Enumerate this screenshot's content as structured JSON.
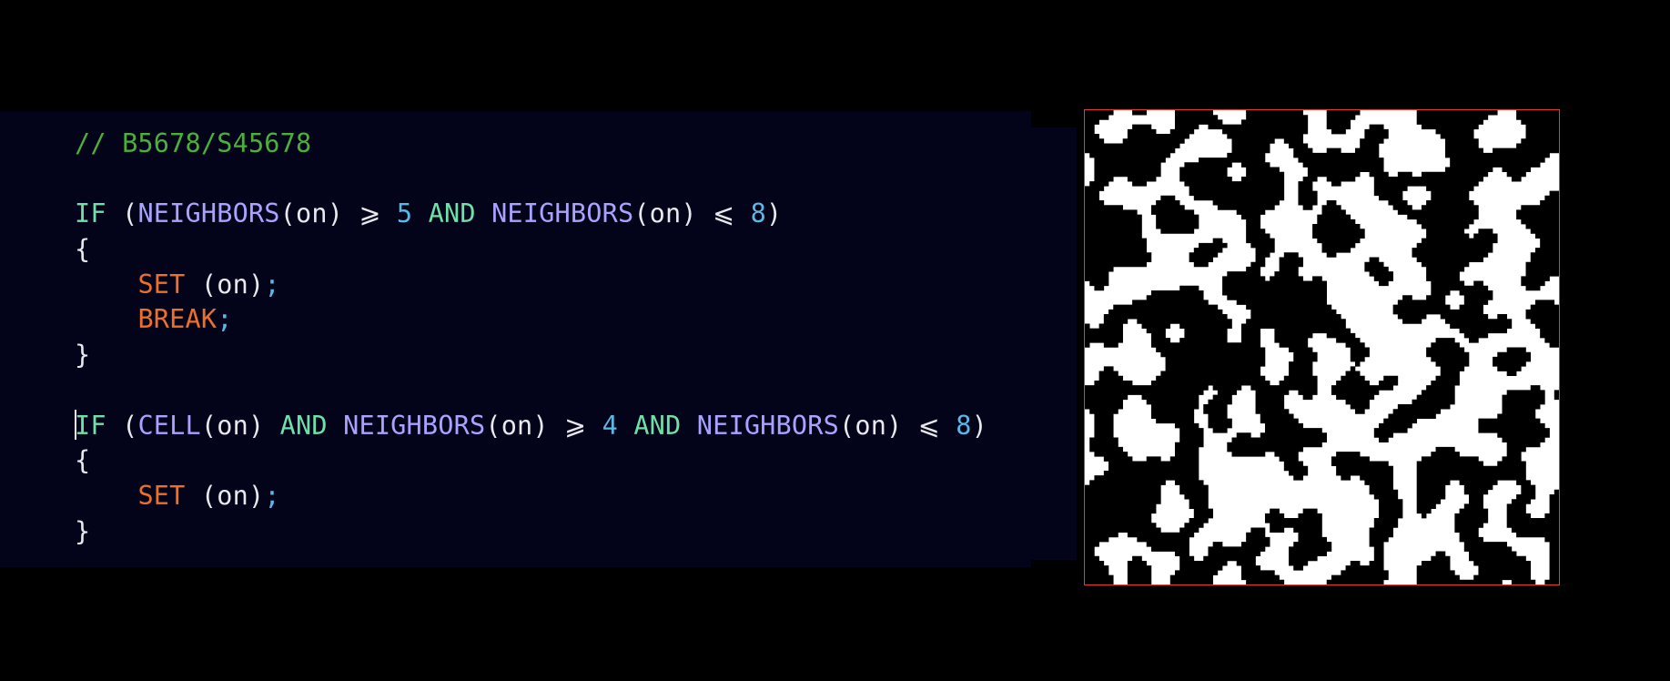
{
  "editor": {
    "lines": [
      [
        {
          "t": "// B5678/S45678",
          "c": "comment"
        }
      ],
      [],
      [
        {
          "t": "IF",
          "c": "kw"
        },
        {
          "t": " (",
          "c": "plain"
        },
        {
          "t": "NEIGHBORS",
          "c": "fn"
        },
        {
          "t": "(on) ",
          "c": "plain"
        },
        {
          "t": "⩾",
          "c": "op"
        },
        {
          "t": " ",
          "c": "plain"
        },
        {
          "t": "5",
          "c": "num"
        },
        {
          "t": " ",
          "c": "plain"
        },
        {
          "t": "AND",
          "c": "kw"
        },
        {
          "t": " ",
          "c": "plain"
        },
        {
          "t": "NEIGHBORS",
          "c": "fn"
        },
        {
          "t": "(on) ",
          "c": "plain"
        },
        {
          "t": "⩽",
          "c": "op"
        },
        {
          "t": " ",
          "c": "plain"
        },
        {
          "t": "8",
          "c": "num"
        },
        {
          "t": ")",
          "c": "plain"
        }
      ],
      [
        {
          "t": "{",
          "c": "plain"
        }
      ],
      [
        {
          "t": "    ",
          "c": "plain"
        },
        {
          "t": "SET",
          "c": "act"
        },
        {
          "t": " (on)",
          "c": "plain"
        },
        {
          "t": ";",
          "c": "semi"
        }
      ],
      [
        {
          "t": "    ",
          "c": "plain"
        },
        {
          "t": "BREAK",
          "c": "act"
        },
        {
          "t": ";",
          "c": "semi"
        }
      ],
      [
        {
          "t": "}",
          "c": "plain"
        }
      ],
      [],
      [
        {
          "t": "",
          "c": "caret"
        },
        {
          "t": "IF",
          "c": "kw"
        },
        {
          "t": " (",
          "c": "plain"
        },
        {
          "t": "CELL",
          "c": "fn"
        },
        {
          "t": "(on) ",
          "c": "plain"
        },
        {
          "t": "AND",
          "c": "kw"
        },
        {
          "t": " ",
          "c": "plain"
        },
        {
          "t": "NEIGHBORS",
          "c": "fn"
        },
        {
          "t": "(on) ",
          "c": "plain"
        },
        {
          "t": "⩾",
          "c": "op"
        },
        {
          "t": " ",
          "c": "plain"
        },
        {
          "t": "4",
          "c": "num"
        },
        {
          "t": " ",
          "c": "plain"
        },
        {
          "t": "AND",
          "c": "kw"
        },
        {
          "t": " ",
          "c": "plain"
        },
        {
          "t": "NEIGHBORS",
          "c": "fn"
        },
        {
          "t": "(on) ",
          "c": "plain"
        },
        {
          "t": "⩽",
          "c": "op"
        },
        {
          "t": " ",
          "c": "plain"
        },
        {
          "t": "8",
          "c": "num"
        },
        {
          "t": ")",
          "c": "plain"
        }
      ],
      [
        {
          "t": "{",
          "c": "plain"
        }
      ],
      [
        {
          "t": "    ",
          "c": "plain"
        },
        {
          "t": "SET",
          "c": "act"
        },
        {
          "t": " (on)",
          "c": "plain"
        },
        {
          "t": ";",
          "c": "semi"
        }
      ],
      [
        {
          "t": "}",
          "c": "plain"
        }
      ]
    ]
  },
  "preview": {
    "alive_color": "#000000",
    "dead_color": "#ffffff",
    "border_color": "#e33b2f"
  },
  "colors": {
    "background": "#000000",
    "editor_background": "#03031a",
    "comment": "#4caf3a",
    "keyword": "#6ee0a8",
    "function": "#a9a2ff",
    "number": "#5ab8e6",
    "action": "#ee6f2a",
    "text": "#e8e8ee"
  }
}
